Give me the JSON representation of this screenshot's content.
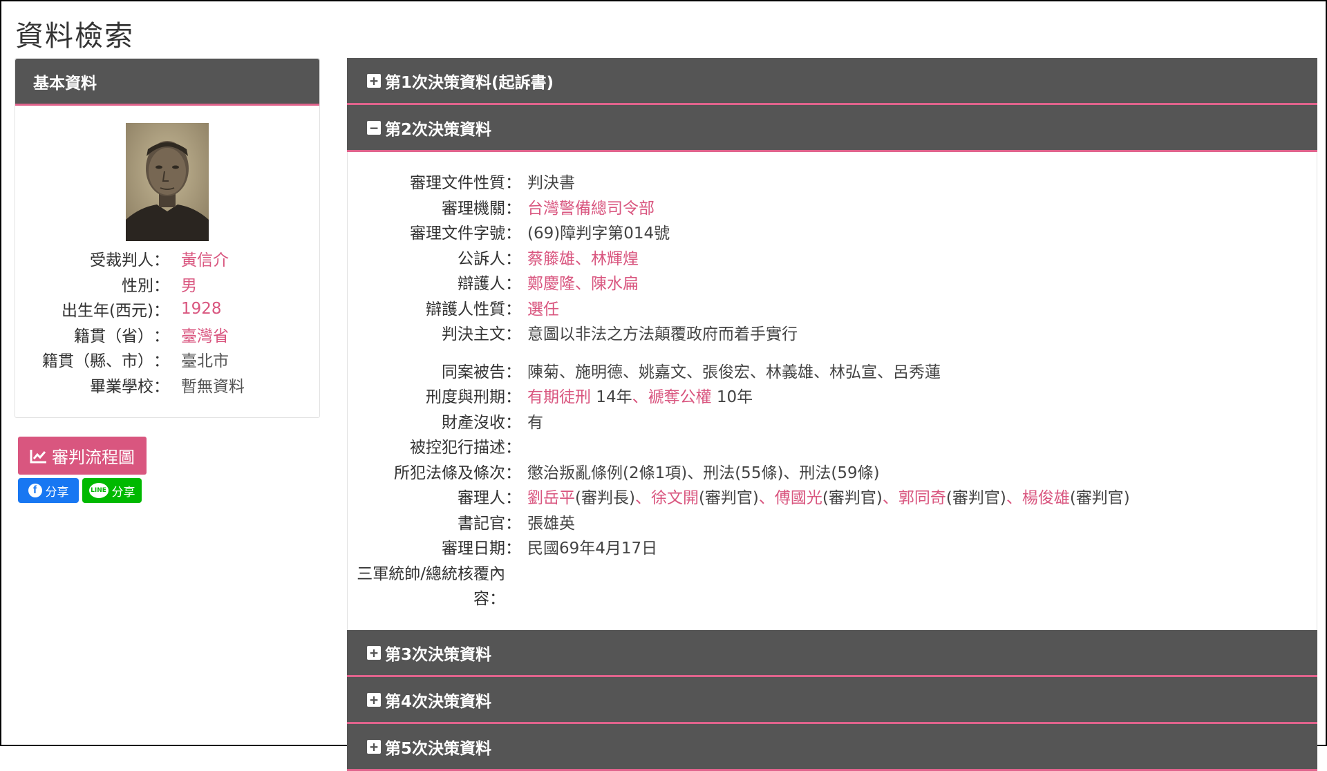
{
  "page_title": "資料檢索",
  "basic_card": {
    "header": "基本資料",
    "rows": [
      {
        "label": "受裁判人",
        "value": "黃信介",
        "link": true
      },
      {
        "label": "性別",
        "value": "男",
        "link": true
      },
      {
        "label": "出生年(西元)",
        "value": "1928",
        "link": true
      },
      {
        "label": "籍貫（省）",
        "value": "臺灣省",
        "link": true
      },
      {
        "label": "籍貫（縣、市）",
        "value": "臺北市",
        "link": false
      },
      {
        "label": "畢業學校",
        "value": "暫無資料",
        "link": false
      }
    ]
  },
  "buttons": {
    "flow_chart": "審判流程圖",
    "fb_share": "分享",
    "line_share": "分享",
    "line_badge": "LINE"
  },
  "accordion": {
    "sections": [
      {
        "title": "第1次決策資料(起訴書)",
        "expanded": false
      },
      {
        "title": "第2次決策資料",
        "expanded": true
      },
      {
        "title": "第3次決策資料",
        "expanded": false
      },
      {
        "title": "第4次決策資料",
        "expanded": false
      },
      {
        "title": "第5次決策資料",
        "expanded": false
      }
    ]
  },
  "detail": {
    "doc_type": {
      "label": "審理文件性質",
      "value": "判決書"
    },
    "agency": {
      "label": "審理機關",
      "value": "台灣警備總司令部"
    },
    "doc_no": {
      "label": "審理文件字號",
      "value": "(69)障判字第014號"
    },
    "prosecutor": {
      "label": "公訴人",
      "names": [
        "蔡籐雄",
        "林輝煌"
      ],
      "sep": "、"
    },
    "defender": {
      "label": "辯護人",
      "names": [
        "鄭慶隆",
        "陳水扁"
      ],
      "sep": "、"
    },
    "defender_type": {
      "label": "辯護人性質",
      "value": "選任"
    },
    "verdict": {
      "label": "判決主文",
      "value": "意圖以非法之方法顛覆政府而着手實行"
    },
    "co_defendants": {
      "label": "同案被告",
      "value": "陳菊、施明德、姚嘉文、張俊宏、林義雄、林弘宣、呂秀蓮"
    },
    "sentence": {
      "label": "刑度與刑期",
      "term1_type": "有期徒刑",
      "term1": " 14年",
      "sep": "、",
      "term2_type": "褫奪公權",
      "term2": " 10年"
    },
    "confiscation": {
      "label": "財產沒收",
      "value": "有"
    },
    "charges_desc": {
      "label": "被控犯行描述",
      "value": ""
    },
    "laws": {
      "label": "所犯法條及條次",
      "value": "懲治叛亂條例(2條1項)、刑法(55條)、刑法(59條)"
    },
    "judges": {
      "label": "審理人",
      "list": [
        {
          "name": "劉岳平",
          "role": "(審判長)"
        },
        {
          "name": "徐文開",
          "role": "(審判官)"
        },
        {
          "name": "傅國光",
          "role": "(審判官)"
        },
        {
          "name": "郭同奇",
          "role": "(審判官)"
        },
        {
          "name": "楊俊雄",
          "role": "(審判官)"
        }
      ],
      "sep": "、"
    },
    "clerk": {
      "label": "書記官",
      "value": "張雄英"
    },
    "date": {
      "label": "審理日期",
      "value": "民國69年4月17日"
    },
    "review": {
      "label_line1": "三軍統帥/總統核覆內",
      "label_line2": "容",
      "value": ""
    }
  },
  "colon": "：",
  "colors": {
    "accent": "#d9567f",
    "header_bg": "#555555",
    "header_border": "#e0638c"
  },
  "icons": {
    "collapsed": "plus-square-icon",
    "expanded": "minus-square-icon"
  }
}
